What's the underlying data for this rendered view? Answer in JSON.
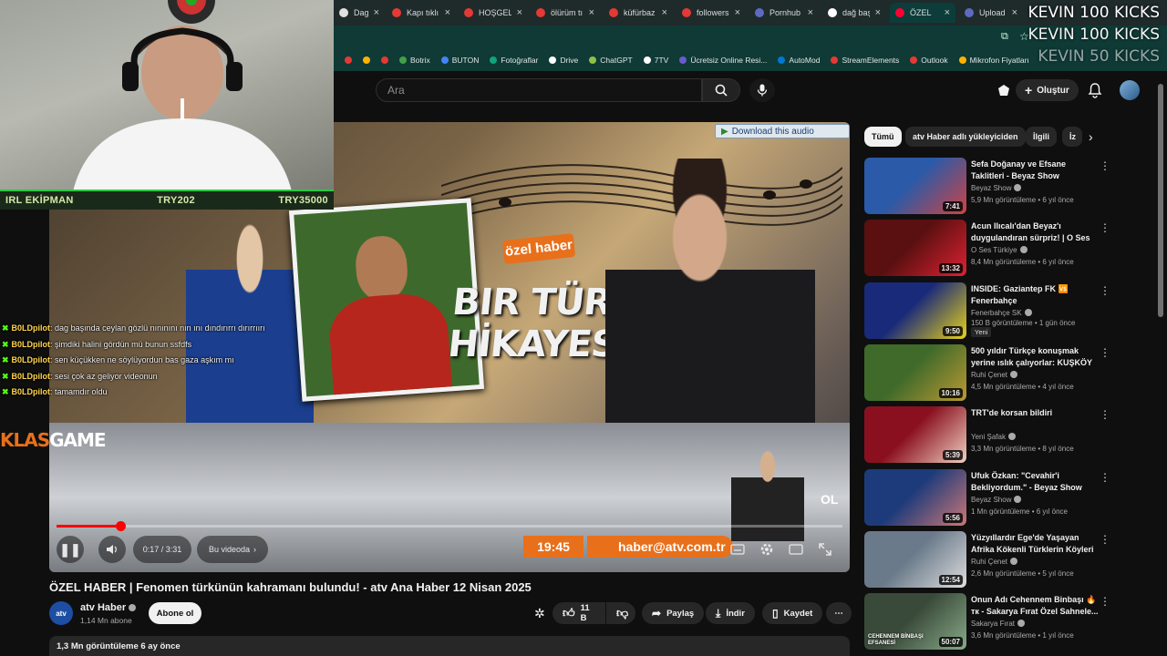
{
  "overlay": {
    "webcam_bar": [
      "IRL EKİPMAN",
      "TRY202",
      "TRY35000"
    ],
    "kicks": [
      "KEVIN  100 KICKS",
      "KEVIN  100 KICKS",
      "KEVIN  50 KICKS"
    ],
    "brand_left": "KLAS",
    "brand_right": "GAME"
  },
  "chat": [
    {
      "user": "B0LDpilot",
      "message": ": dag başında ceylan gözlü nınınını nın ını dındırırrı dırırrıırı"
    },
    {
      "user": "B0LDpilot",
      "message": ": şimdiki halini gördün mü bunun ssfdfs"
    },
    {
      "user": "B0LDpilot",
      "message": ": sen küçükken ne söylüyordun bas gaza aşkım mı"
    },
    {
      "user": "B0LDpilot",
      "message": ": sesi çok az geliyor videonun"
    },
    {
      "user": "B0LDpilot",
      "message": ": tamamdır oldu"
    }
  ],
  "browser": {
    "tabs": [
      {
        "label": "Dag başı",
        "color": "#e0e0e0"
      },
      {
        "label": "Kapı tıklı",
        "color": "#e53935"
      },
      {
        "label": "HOŞGELİ",
        "color": "#e53935"
      },
      {
        "label": "ölürüm tı",
        "color": "#e53935"
      },
      {
        "label": "küfürbaz",
        "color": "#e53935"
      },
      {
        "label": "followers",
        "color": "#e53935"
      },
      {
        "label": "Pornhub",
        "color": "#5c6bc0"
      },
      {
        "label": "dağ başı",
        "color": "#ffffff"
      },
      {
        "label": "ÖZEL",
        "color": "#ff0033"
      },
      {
        "label": "Upload",
        "color": "#5c6bc0"
      }
    ],
    "bookmarks": [
      "Botrix",
      "BUTON",
      "Fotoğraflar",
      "Drive",
      "ChatGPT",
      "7TV",
      "Ücretsiz Online Resi...",
      "AutoMod",
      "StreamElements",
      "Outlook",
      "Mikrofon Fiyatları"
    ]
  },
  "youtube": {
    "search_placeholder": "Ara",
    "create_label": "Oluştur"
  },
  "video": {
    "download_label": "Download this audio",
    "badge": "özel haber",
    "overlay_title_1": "BIR TÜRKÜ",
    "overlay_title_2": "HİKAYESİ..",
    "ticker_time": "19:45",
    "ticker_mail": "haber@atv.com.tr",
    "time": "0:17 / 3:31",
    "chapter": "Bu videoda",
    "progress": 0.081,
    "title": "ÖZEL HABER | Fenomen türkünün kahramanı bulundu! - atv Ana Haber 12 Nisan 2025",
    "channel": "atv Haber",
    "channel_avatar": "atv",
    "subscribers": "1,14 Mn abone",
    "subscribe_label": "Abone ol",
    "likes": "11 B",
    "share": "Paylaş",
    "download": "İndir",
    "save": "Kaydet",
    "views_date": "1,3 Mn görüntüleme  6 ay önce"
  },
  "chips": [
    "Tümü",
    "atv Haber adlı yükleyiciden",
    "İlgili",
    "İz"
  ],
  "recommendations": [
    {
      "title": "Sefa Doğanay ve Efsane Taklitleri - Beyaz Show",
      "channel": "Beyaz Show",
      "meta": "5,9 Mn görüntüleme • 6 yıl önce",
      "duration": "7:41",
      "colors": [
        "#2a5aa8",
        "#c44"
      ]
    },
    {
      "title": "Acun Ilıcalı'dan Beyaz'ı duygulandıran sürpriz! | O Ses ...",
      "channel": "O Ses Türkiye",
      "meta": "8,4 Mn görüntüleme • 6 yıl önce",
      "duration": "13:32",
      "colors": [
        "#5a1010",
        "#d23"
      ]
    },
    {
      "title": "INSIDE: Gaziantep FK 🆚 Fenerbahçe",
      "channel": "Fenerbahçe SK",
      "meta": "150 B görüntüleme • 1 gün önce",
      "duration": "9:50",
      "colors": [
        "#1a2a7a",
        "#e8d21a"
      ],
      "new": "Yeni"
    },
    {
      "title": "500 yıldır Türkçe konuşmak yerine ıslık çalıyorlar: KUŞKÖY",
      "channel": "Ruhi Çenet",
      "meta": "4,5 Mn görüntüleme • 4 yıl önce",
      "duration": "10:16",
      "colors": [
        "#3f6a2a",
        "#b93"
      ]
    },
    {
      "title": "TRT'de korsan bildiri",
      "channel": "Yeni Şafak",
      "meta": "3,3 Mn görüntüleme • 8 yıl önce",
      "duration": "5:39",
      "colors": [
        "#8a1020",
        "#f0d0c0"
      ]
    },
    {
      "title": "Ufuk Özkan: \"Cevahir'i Bekliyordum.\" - Beyaz Show",
      "channel": "Beyaz Show",
      "meta": "1 Mn görüntüleme • 6 yıl önce",
      "duration": "5:56",
      "colors": [
        "#1d3b7a",
        "#c77"
      ]
    },
    {
      "title": "Yüzyıllardır Ege'de Yaşayan Afrika Kökenli Türklerin Köyleri",
      "channel": "Ruhi Çenet",
      "meta": "2,6 Mn görüntüleme • 5 yıl önce",
      "duration": "12:54",
      "colors": [
        "#6a7a8a",
        "#ddd"
      ]
    },
    {
      "title": "Onun Adı Cehennem Binbaşı 🔥 тк - Sakarya Fırat Özel Sahnele...",
      "channel": "Sakarya Fırat",
      "meta": "3,6 Mn görüntüleme • 1 yıl önce",
      "duration": "50:07",
      "colors": [
        "#3a4a3a",
        "#8a8"
      ],
      "thumb_text": "CEHENNEM BİNBAŞI EFSANESİ"
    }
  ],
  "colors": {
    "accent": "#ff0000",
    "kick_green": "#53fc18",
    "atv_orange": "#e8701b"
  }
}
